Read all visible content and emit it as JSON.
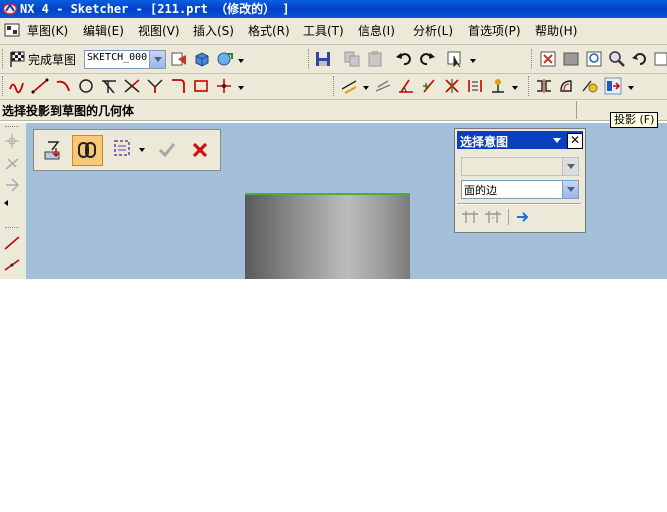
{
  "window": {
    "title": "NX 4 - Sketcher - [211.prt （修改的） ]"
  },
  "menu": [
    {
      "label": "草图(K)"
    },
    {
      "label": "编辑(E)"
    },
    {
      "label": "视图(V)"
    },
    {
      "label": "插入(S)"
    },
    {
      "label": "格式(R)"
    },
    {
      "label": "工具(T)"
    },
    {
      "label": "信息(I)"
    },
    {
      "label": "分析(L)"
    },
    {
      "label": "首选项(P)"
    },
    {
      "label": "帮助(H)"
    }
  ],
  "toolbar": {
    "finish_sketch_label": "完成草图",
    "sketch_name": "SKETCH_000"
  },
  "cue_line": {
    "text": "选择投影到草图的几何体"
  },
  "tooltip": {
    "text": "投影 (F)"
  },
  "dialog": {
    "title": "选择意图",
    "combo1_value": "",
    "combo2_value": "面的边"
  },
  "colors": {
    "title_blue": "#0341c8",
    "viewport_bg": "#a3bfda",
    "edge_green": "#4caf2a",
    "cancel_red": "#d01010"
  }
}
